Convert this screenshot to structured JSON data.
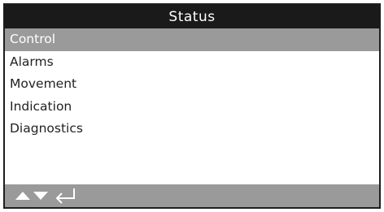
{
  "header": {
    "title": "Status"
  },
  "menu": {
    "items": [
      {
        "label": "Control",
        "selected": true
      },
      {
        "label": "Alarms",
        "selected": false
      },
      {
        "label": "Movement",
        "selected": false
      },
      {
        "label": "Indication",
        "selected": false
      },
      {
        "label": "Diagnostics",
        "selected": false
      }
    ]
  },
  "footer": {
    "icons": [
      "up-arrow-icon",
      "down-arrow-icon",
      "enter-icon"
    ]
  },
  "colors": {
    "title_bar": "#1a1a1a",
    "selection": "#9a9a9a",
    "footer_bar": "#9a9a9a",
    "text": "#222222"
  }
}
